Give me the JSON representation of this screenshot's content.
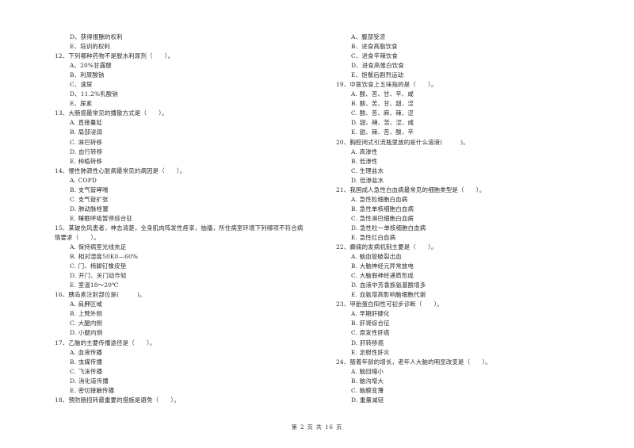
{
  "left_column": [
    {
      "type": "opt",
      "text": "D、获得报酬的权利"
    },
    {
      "type": "opt",
      "text": "E、培训的权利"
    },
    {
      "type": "q",
      "text": "12、下列哪种药物不是脱水利尿剂（　　）。"
    },
    {
      "type": "opt",
      "text": "A、20%甘露醇"
    },
    {
      "type": "opt",
      "text": "B、利尿酸钠"
    },
    {
      "type": "opt",
      "text": "C、速尿"
    },
    {
      "type": "opt",
      "text": "D、11.2%乳酸钠"
    },
    {
      "type": "opt",
      "text": "E、尿素"
    },
    {
      "type": "q",
      "text": "13、大肠癌最常见的播散方式是（　　）。"
    },
    {
      "type": "opt",
      "text": "A. 直接蔓延"
    },
    {
      "type": "opt",
      "text": "B. 局部浸润"
    },
    {
      "type": "opt",
      "text": "C. 淋巴转移"
    },
    {
      "type": "opt",
      "text": "D. 血行转移"
    },
    {
      "type": "opt",
      "text": "E. 种植转移"
    },
    {
      "type": "q",
      "text": "14、慢性肺源性心脏病最常见的病因是（　　）。"
    },
    {
      "type": "opt",
      "text": "A. COPD"
    },
    {
      "type": "opt",
      "text": "B. 支气管哮喘"
    },
    {
      "type": "opt",
      "text": "C. 支气管扩张"
    },
    {
      "type": "opt",
      "text": "D. 肺动脉栓塞"
    },
    {
      "type": "opt",
      "text": "E. 睡眠呼吸暂停综合征"
    },
    {
      "type": "q",
      "text": "15、某破伤风患者，神志清楚，全身肌肉阵发性痉挛，抽搐，所住病室环境下列哪项不符合病"
    },
    {
      "type": "q",
      "text": "情要求（　　）。"
    },
    {
      "type": "opt",
      "text": "A. 保持病室光线充足"
    },
    {
      "type": "opt",
      "text": "B. 相对湿度50K0—60%"
    },
    {
      "type": "opt",
      "text": "C. 门、椅脚钉橡皮垫"
    },
    {
      "type": "opt",
      "text": "D. 开门、关门动作轻"
    },
    {
      "type": "opt",
      "text": "E. 室温18～20℃"
    },
    {
      "type": "q",
      "text": "16、胰岛素注射部位是(　　　)。"
    },
    {
      "type": "opt",
      "text": "A. 肩胛区域"
    },
    {
      "type": "opt",
      "text": "B. 上臂外侧"
    },
    {
      "type": "opt",
      "text": "C. 大腿内侧"
    },
    {
      "type": "opt",
      "text": "D. 小腿内侧"
    },
    {
      "type": "q",
      "text": "17、乙脑的主要传播途径是（　　）。"
    },
    {
      "type": "opt",
      "text": "A. 血液传播"
    },
    {
      "type": "opt",
      "text": "B. 虫媒传播"
    },
    {
      "type": "opt",
      "text": "C. 飞沫传播"
    },
    {
      "type": "opt",
      "text": "D. 消化道传播"
    },
    {
      "type": "opt",
      "text": "E. 密切接触传播"
    },
    {
      "type": "q",
      "text": "18、预防肠扭转最重要的措施是避免（　　）。"
    }
  ],
  "right_column": [
    {
      "type": "opt",
      "text": "A、腹部受凉"
    },
    {
      "type": "opt",
      "text": "B、进食高脂饮食"
    },
    {
      "type": "opt",
      "text": "C、进食辛辣饮食"
    },
    {
      "type": "opt",
      "text": "D、进食高蛋白饮食"
    },
    {
      "type": "opt",
      "text": "E、饱餐后剧烈运动"
    },
    {
      "type": "q",
      "text": "19、中医饮食上五味指的是（　　）。"
    },
    {
      "type": "opt",
      "text": "A. 酸、苦、甘、辛、咸"
    },
    {
      "type": "opt",
      "text": "B. 酸、苦、甘、甜、涩"
    },
    {
      "type": "opt",
      "text": "C. 酸、苦、麻、辣、涩"
    },
    {
      "type": "opt",
      "text": "D. 甜、辣、苦、涩、咸"
    },
    {
      "type": "opt",
      "text": "E. 甜、辣、苦、酸、辛"
    },
    {
      "type": "q",
      "text": "20、胸腔闭式引流瓶里放的是什么溶液(　　　)。"
    },
    {
      "type": "opt",
      "text": "A. 高渗性"
    },
    {
      "type": "opt",
      "text": "B. 低渗性"
    },
    {
      "type": "opt",
      "text": "C. 生理盐水"
    },
    {
      "type": "opt",
      "text": "D. 低渗盐水"
    },
    {
      "type": "q",
      "text": "21、我国成人急性白血病最常见的细胞类型是（　　）。"
    },
    {
      "type": "opt",
      "text": "A. 急性粒细胞白血病"
    },
    {
      "type": "opt",
      "text": "B. 急性单核细胞白血病"
    },
    {
      "type": "opt",
      "text": "C. 急性淋巴细胞白血病"
    },
    {
      "type": "opt",
      "text": "D. 急性粒一单核细胞白血病"
    },
    {
      "type": "opt",
      "text": "E. 急性红白血病"
    },
    {
      "type": "q",
      "text": "22、癫痫的发病机制主要是（　　）。"
    },
    {
      "type": "opt",
      "text": "A. 脑血管破裂出血"
    },
    {
      "type": "opt",
      "text": "B. 大脑神经元异常放电"
    },
    {
      "type": "opt",
      "text": "C. 大脑假神经递质形成"
    },
    {
      "type": "opt",
      "text": "D. 血液中芳香族氨基酸增多"
    },
    {
      "type": "opt",
      "text": "E. 血氨增高影响脑细胞代谢"
    },
    {
      "type": "q",
      "text": "23、甲胎蛋白阳性可初步诊断（　　）。"
    },
    {
      "type": "opt",
      "text": "A. 早期肝硬化"
    },
    {
      "type": "opt",
      "text": "B. 肝肾综合征"
    },
    {
      "type": "opt",
      "text": "C. 原发性肝癌"
    },
    {
      "type": "opt",
      "text": "D. 肝转移癌"
    },
    {
      "type": "opt",
      "text": "E. 淤胆性肝炎"
    },
    {
      "type": "q",
      "text": "24、随着年龄的增长，老年人大脑的明显改变是（　　）。"
    },
    {
      "type": "opt",
      "text": "A. 脑回缩小"
    },
    {
      "type": "opt",
      "text": "B. 脑沟增大"
    },
    {
      "type": "opt",
      "text": "C. 脑膜变薄"
    },
    {
      "type": "opt",
      "text": "D. 重量减轻"
    }
  ],
  "footer": {
    "page_label": "第 2 页 共 16 页"
  }
}
